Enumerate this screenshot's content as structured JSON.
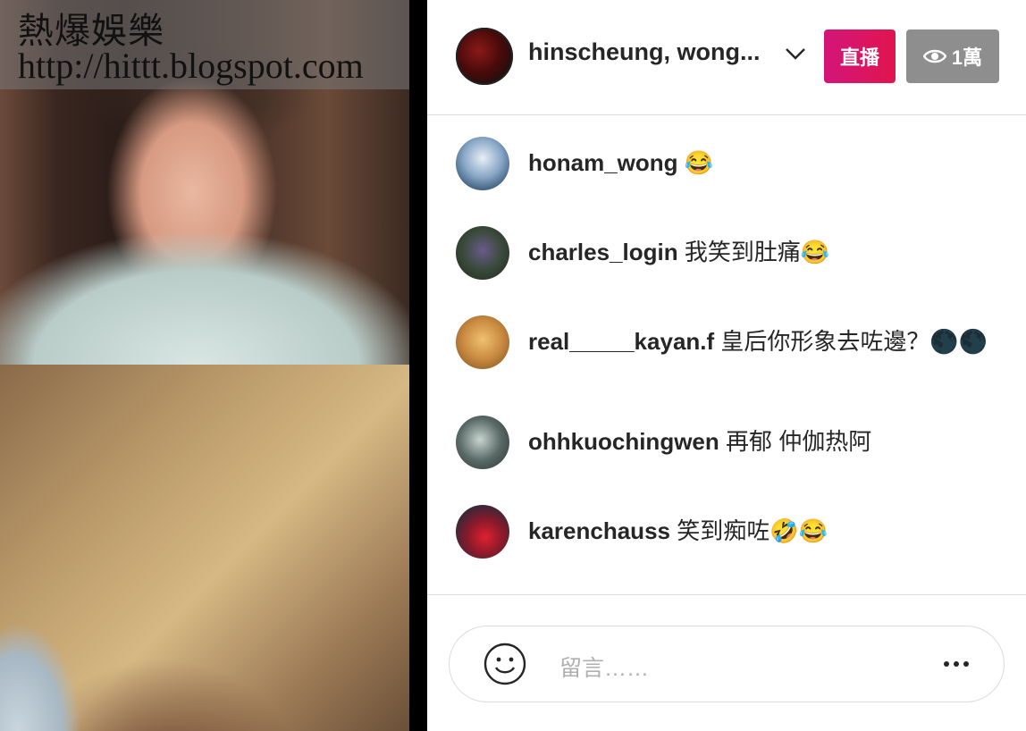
{
  "watermark": {
    "line1": "熱爆娛樂",
    "line2": "http://hittt.blogspot.com"
  },
  "header": {
    "title": "hinscheung, wong...",
    "live_label": "直播",
    "viewer_count": "1萬"
  },
  "comments": [
    {
      "user": "honam_wong",
      "text": "😂"
    },
    {
      "user": "charles_login",
      "text": "我笑到肚痛😂"
    },
    {
      "user": "real_____kayan.f",
      "text": "皇后你形象去咗邊？🌑🌑"
    },
    {
      "user": "ohhkuochingwen",
      "text": "再郁 仲伽热阿"
    },
    {
      "user": "karenchauss",
      "text": "笑到痴咗🤣😂"
    }
  ],
  "input": {
    "placeholder": "留言……"
  },
  "colors": {
    "live_accent": "#d3157a",
    "viewer_badge": "#8e8e8e",
    "text": "#262626"
  }
}
